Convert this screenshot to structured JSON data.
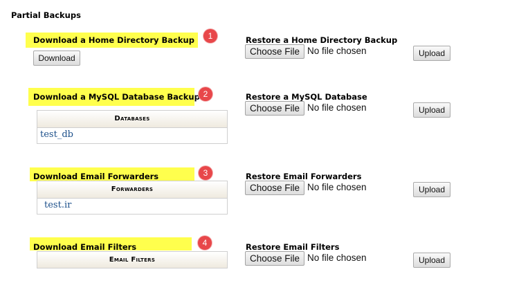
{
  "section_title": "Partial Backups",
  "download_items": [
    {
      "badge": "1",
      "label": "Download a Home Directory Backup",
      "button": "Download"
    },
    {
      "badge": "2",
      "label": "Download a MySQL Database Backup",
      "table_header": "Databases",
      "rows": [
        "test_db"
      ]
    },
    {
      "badge": "3",
      "label": "Download Email Forwarders",
      "table_header": "Forwarders",
      "rows": [
        "test.ir"
      ]
    },
    {
      "badge": "4",
      "label": "Download Email Filters",
      "table_header": "Email Filters"
    }
  ],
  "restore_items": [
    {
      "label": "Restore a Home Directory Backup",
      "choose": "Choose File",
      "no_file": "No file chosen",
      "upload": "Upload"
    },
    {
      "label": "Restore a MySQL Database",
      "choose": "Choose File",
      "no_file": "No file chosen",
      "upload": "Upload"
    },
    {
      "label": "Restore Email Forwarders",
      "choose": "Choose File",
      "no_file": "No file chosen",
      "upload": "Upload"
    },
    {
      "label": "Restore Email Filters",
      "choose": "Choose File",
      "no_file": "No file chosen",
      "upload": "Upload"
    }
  ],
  "colors": {
    "highlight": "#ffff4d",
    "badge": "#e8474a",
    "link": "#1b4f8a"
  }
}
